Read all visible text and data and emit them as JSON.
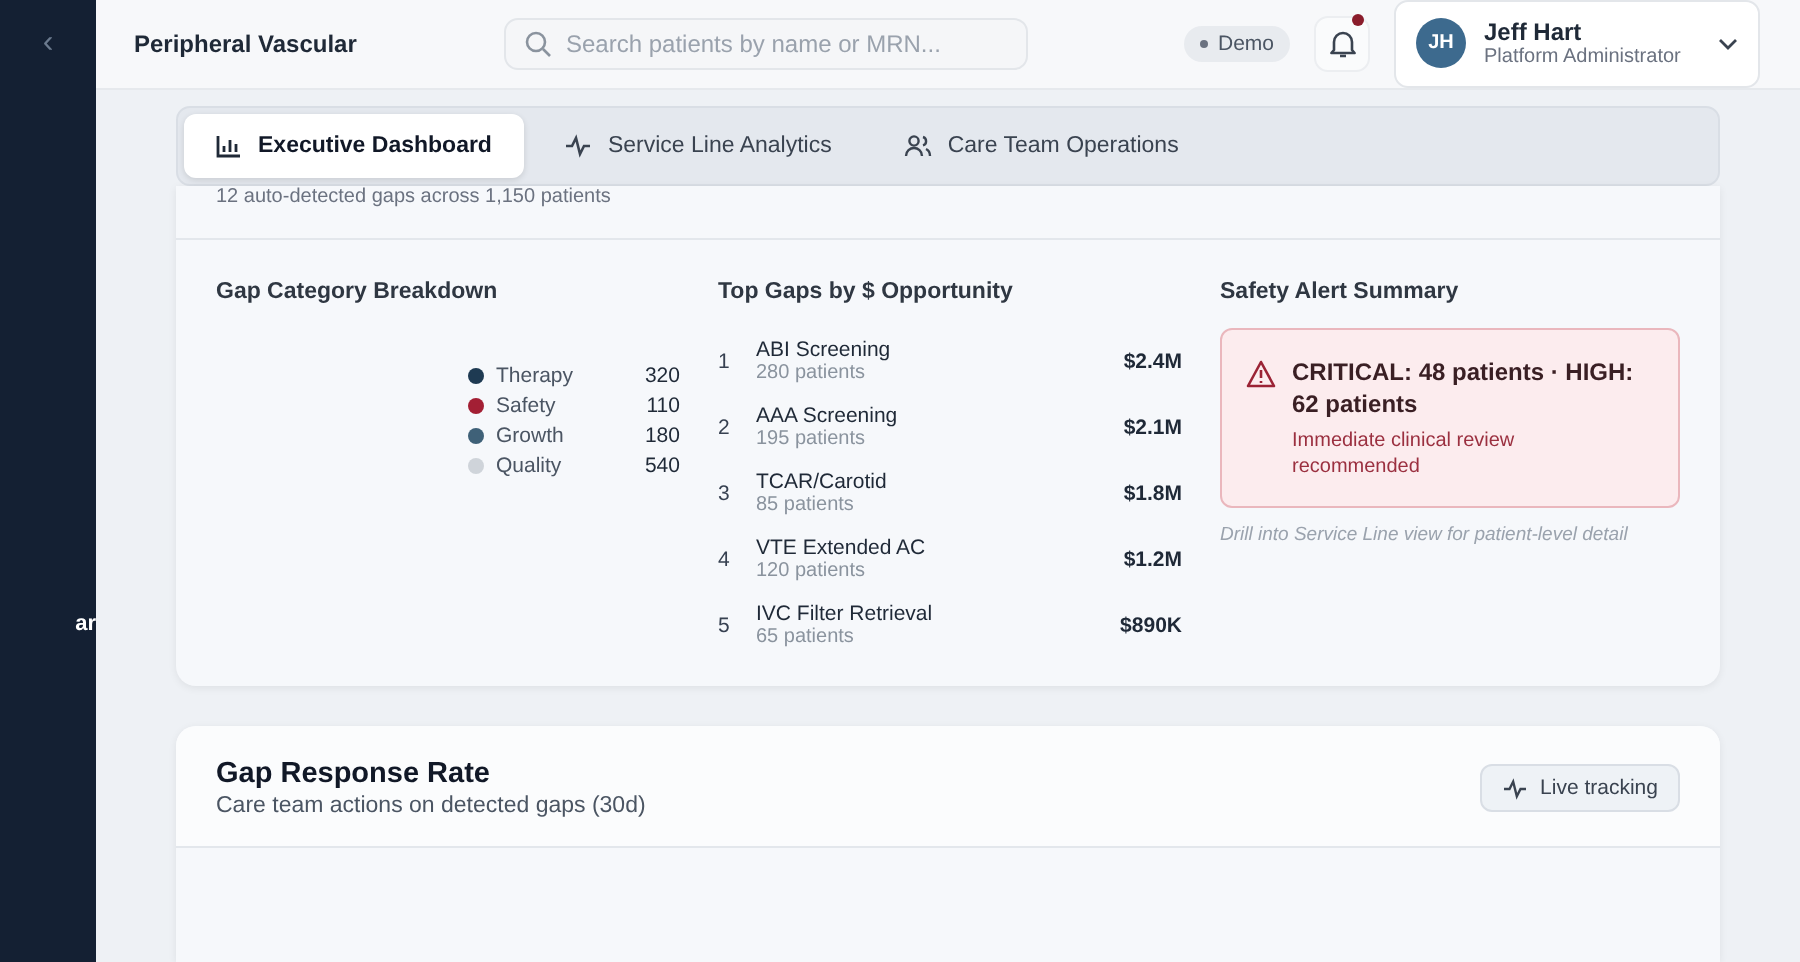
{
  "sidebar": {
    "collapse_icon": "‹",
    "label": "ar"
  },
  "header": {
    "title": "Peripheral Vascular",
    "search": {
      "placeholder": "Search patients by name or MRN..."
    },
    "env_badge": "Demo",
    "notifications": {
      "unread": true
    },
    "user": {
      "initials": "JH",
      "name": "Jeff Hart",
      "role": "Platform Administrator"
    }
  },
  "tabs": [
    {
      "label": "Executive Dashboard",
      "kind": "bars",
      "selected": true
    },
    {
      "label": "Service Line Analytics",
      "kind": "pulse",
      "selected": false
    },
    {
      "label": "Care Team Operations",
      "kind": "people",
      "selected": false
    }
  ],
  "overview_card": {
    "subtitle": "12 auto-detected gaps across 1,150 patients",
    "breakdown": {
      "title": "Gap Category Breakdown",
      "items": [
        {
          "name": "Therapy",
          "value": "320",
          "color": "#1e3a52"
        },
        {
          "name": "Safety",
          "value": "110",
          "color": "#a31f34"
        },
        {
          "name": "Growth",
          "value": "180",
          "color": "#3f6178"
        },
        {
          "name": "Quality",
          "value": "540",
          "color": "#cfd4da"
        }
      ]
    },
    "top_gaps": {
      "title": "Top Gaps by $ Opportunity",
      "items": [
        {
          "rank": "1",
          "name": "ABI Screening",
          "patients": "280 patients",
          "amount": "$2.4M"
        },
        {
          "rank": "2",
          "name": "AAA Screening",
          "patients": "195 patients",
          "amount": "$2.1M"
        },
        {
          "rank": "3",
          "name": "TCAR/Carotid",
          "patients": "85 patients",
          "amount": "$1.8M"
        },
        {
          "rank": "4",
          "name": "VTE Extended AC",
          "patients": "120 patients",
          "amount": "$1.2M"
        },
        {
          "rank": "5",
          "name": "IVC Filter Retrieval",
          "patients": "65 patients",
          "amount": "$890K"
        }
      ]
    },
    "safety": {
      "title": "Safety Alert Summary",
      "alert": "CRITICAL: 48 patients · HIGH: 62 patients",
      "detail": "Immediate clinical review recommended",
      "note": "Drill into Service Line view for patient-level detail"
    }
  },
  "response_card": {
    "title": "Gap Response Rate",
    "subtitle": "Care team actions on detected gaps (30d)",
    "badge": "Live tracking"
  }
}
